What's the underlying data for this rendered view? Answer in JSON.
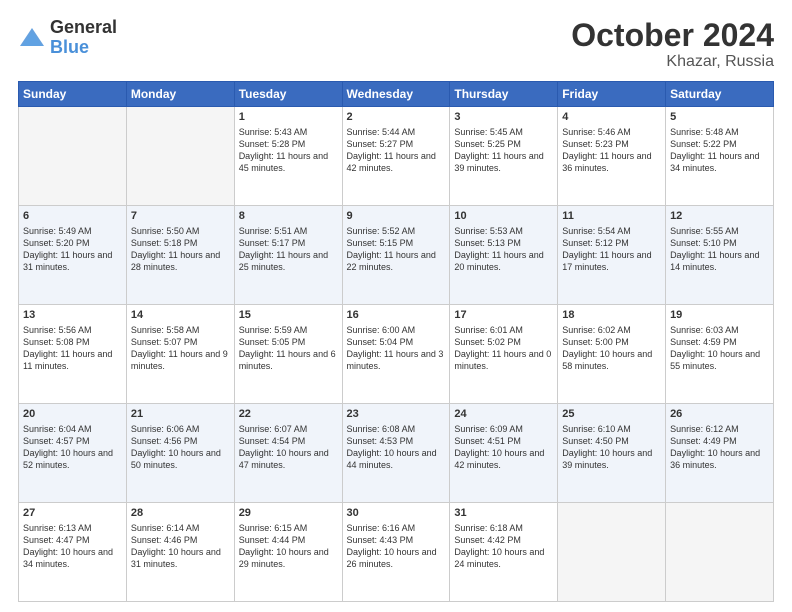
{
  "header": {
    "logo_general": "General",
    "logo_blue": "Blue",
    "month": "October 2024",
    "location": "Khazar, Russia"
  },
  "weekdays": [
    "Sunday",
    "Monday",
    "Tuesday",
    "Wednesday",
    "Thursday",
    "Friday",
    "Saturday"
  ],
  "rows": [
    [
      {
        "day": "",
        "info": ""
      },
      {
        "day": "",
        "info": ""
      },
      {
        "day": "1",
        "info": "Sunrise: 5:43 AM\nSunset: 5:28 PM\nDaylight: 11 hours and 45 minutes."
      },
      {
        "day": "2",
        "info": "Sunrise: 5:44 AM\nSunset: 5:27 PM\nDaylight: 11 hours and 42 minutes."
      },
      {
        "day": "3",
        "info": "Sunrise: 5:45 AM\nSunset: 5:25 PM\nDaylight: 11 hours and 39 minutes."
      },
      {
        "day": "4",
        "info": "Sunrise: 5:46 AM\nSunset: 5:23 PM\nDaylight: 11 hours and 36 minutes."
      },
      {
        "day": "5",
        "info": "Sunrise: 5:48 AM\nSunset: 5:22 PM\nDaylight: 11 hours and 34 minutes."
      }
    ],
    [
      {
        "day": "6",
        "info": "Sunrise: 5:49 AM\nSunset: 5:20 PM\nDaylight: 11 hours and 31 minutes."
      },
      {
        "day": "7",
        "info": "Sunrise: 5:50 AM\nSunset: 5:18 PM\nDaylight: 11 hours and 28 minutes."
      },
      {
        "day": "8",
        "info": "Sunrise: 5:51 AM\nSunset: 5:17 PM\nDaylight: 11 hours and 25 minutes."
      },
      {
        "day": "9",
        "info": "Sunrise: 5:52 AM\nSunset: 5:15 PM\nDaylight: 11 hours and 22 minutes."
      },
      {
        "day": "10",
        "info": "Sunrise: 5:53 AM\nSunset: 5:13 PM\nDaylight: 11 hours and 20 minutes."
      },
      {
        "day": "11",
        "info": "Sunrise: 5:54 AM\nSunset: 5:12 PM\nDaylight: 11 hours and 17 minutes."
      },
      {
        "day": "12",
        "info": "Sunrise: 5:55 AM\nSunset: 5:10 PM\nDaylight: 11 hours and 14 minutes."
      }
    ],
    [
      {
        "day": "13",
        "info": "Sunrise: 5:56 AM\nSunset: 5:08 PM\nDaylight: 11 hours and 11 minutes."
      },
      {
        "day": "14",
        "info": "Sunrise: 5:58 AM\nSunset: 5:07 PM\nDaylight: 11 hours and 9 minutes."
      },
      {
        "day": "15",
        "info": "Sunrise: 5:59 AM\nSunset: 5:05 PM\nDaylight: 11 hours and 6 minutes."
      },
      {
        "day": "16",
        "info": "Sunrise: 6:00 AM\nSunset: 5:04 PM\nDaylight: 11 hours and 3 minutes."
      },
      {
        "day": "17",
        "info": "Sunrise: 6:01 AM\nSunset: 5:02 PM\nDaylight: 11 hours and 0 minutes."
      },
      {
        "day": "18",
        "info": "Sunrise: 6:02 AM\nSunset: 5:00 PM\nDaylight: 10 hours and 58 minutes."
      },
      {
        "day": "19",
        "info": "Sunrise: 6:03 AM\nSunset: 4:59 PM\nDaylight: 10 hours and 55 minutes."
      }
    ],
    [
      {
        "day": "20",
        "info": "Sunrise: 6:04 AM\nSunset: 4:57 PM\nDaylight: 10 hours and 52 minutes."
      },
      {
        "day": "21",
        "info": "Sunrise: 6:06 AM\nSunset: 4:56 PM\nDaylight: 10 hours and 50 minutes."
      },
      {
        "day": "22",
        "info": "Sunrise: 6:07 AM\nSunset: 4:54 PM\nDaylight: 10 hours and 47 minutes."
      },
      {
        "day": "23",
        "info": "Sunrise: 6:08 AM\nSunset: 4:53 PM\nDaylight: 10 hours and 44 minutes."
      },
      {
        "day": "24",
        "info": "Sunrise: 6:09 AM\nSunset: 4:51 PM\nDaylight: 10 hours and 42 minutes."
      },
      {
        "day": "25",
        "info": "Sunrise: 6:10 AM\nSunset: 4:50 PM\nDaylight: 10 hours and 39 minutes."
      },
      {
        "day": "26",
        "info": "Sunrise: 6:12 AM\nSunset: 4:49 PM\nDaylight: 10 hours and 36 minutes."
      }
    ],
    [
      {
        "day": "27",
        "info": "Sunrise: 6:13 AM\nSunset: 4:47 PM\nDaylight: 10 hours and 34 minutes."
      },
      {
        "day": "28",
        "info": "Sunrise: 6:14 AM\nSunset: 4:46 PM\nDaylight: 10 hours and 31 minutes."
      },
      {
        "day": "29",
        "info": "Sunrise: 6:15 AM\nSunset: 4:44 PM\nDaylight: 10 hours and 29 minutes."
      },
      {
        "day": "30",
        "info": "Sunrise: 6:16 AM\nSunset: 4:43 PM\nDaylight: 10 hours and 26 minutes."
      },
      {
        "day": "31",
        "info": "Sunrise: 6:18 AM\nSunset: 4:42 PM\nDaylight: 10 hours and 24 minutes."
      },
      {
        "day": "",
        "info": ""
      },
      {
        "day": "",
        "info": ""
      }
    ]
  ]
}
